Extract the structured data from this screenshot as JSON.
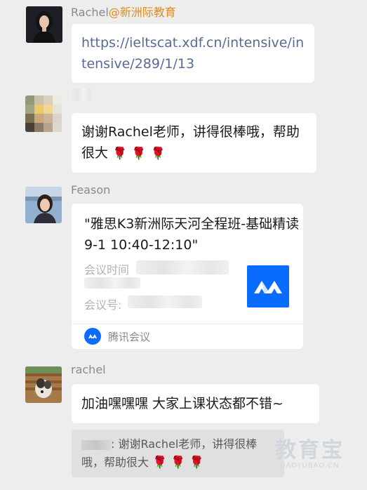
{
  "messages": [
    {
      "sender": "Rachel",
      "sender_org": "@新洲际教育",
      "avatar_icon": "woman-portrait-avatar",
      "type": "link",
      "text": "https://ieltscat.xdf.cn/intensive/intensive/289/1/13"
    },
    {
      "sender": "",
      "avatar_icon": "blurred-avatar",
      "type": "text",
      "text": "谢谢Rachel老师，讲得很棒哦，帮助很大",
      "emoji": [
        "🌹",
        "🌹",
        "🌹"
      ]
    },
    {
      "sender": "Feason",
      "avatar_icon": "woman-portrait-avatar",
      "type": "meeting-card",
      "card": {
        "title": "\"雅思K3新洲际天河全程班-基础精读9-1 10:40-12:10\"",
        "time_label": "会议时间",
        "id_label": "会议号:",
        "app_name": "腾讯会议",
        "logo_icon": "tencent-meeting-logo-icon"
      }
    },
    {
      "sender": "rachel",
      "avatar_icon": "dog-photo-avatar",
      "type": "text",
      "text": "加油嘿嘿嘿 大家上课状态都不错~",
      "quote": {
        "text": ": 谢谢Rachel老师，讲得很棒哦，帮助很大",
        "emoji": [
          "🌹",
          "🌹",
          "🌹"
        ]
      }
    }
  ],
  "watermark": {
    "main": "教育宝",
    "sub": "JIAOYUBAO.CN"
  },
  "colors": {
    "background": "#ededed",
    "bubble": "#ffffff",
    "link": "#576b95",
    "org_name": "#e38a16",
    "meeting_blue": "#0a6cff"
  }
}
